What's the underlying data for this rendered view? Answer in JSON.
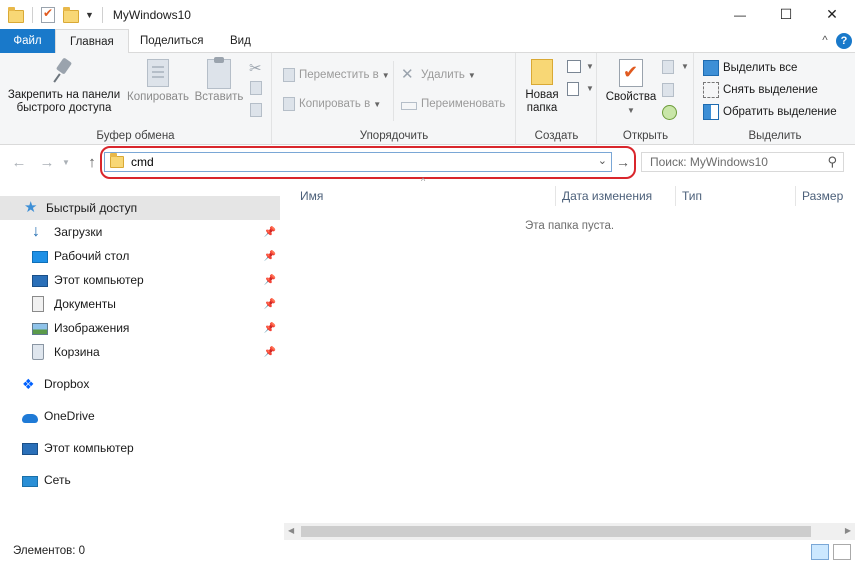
{
  "window": {
    "title": "MyWindows10",
    "minimize_glyph": "—",
    "maximize_glyph": "☐",
    "close_glyph": "✕"
  },
  "tabs": {
    "file": "Файл",
    "home": "Главная",
    "share": "Поделиться",
    "view": "Вид",
    "collapse_glyph": "^",
    "help_glyph": "?"
  },
  "ribbon": {
    "clipboard": {
      "label": "Буфер обмена",
      "pin_line1": "Закрепить на панели",
      "pin_line2": "быстрого доступа",
      "copy": "Копировать",
      "paste": "Вставить"
    },
    "organize": {
      "label": "Упорядочить",
      "move_to": "Переместить в",
      "copy_to": "Копировать в",
      "delete": "Удалить",
      "rename": "Переименовать"
    },
    "new": {
      "label": "Создать",
      "new_folder_line1": "Новая",
      "new_folder_line2": "папка"
    },
    "open": {
      "label": "Открыть",
      "properties": "Свойства"
    },
    "select": {
      "label": "Выделить",
      "select_all": "Выделить все",
      "select_none": "Снять выделение",
      "invert": "Обратить выделение"
    }
  },
  "address": {
    "value": "cmd",
    "search_placeholder": "Поиск: MyWindows10"
  },
  "nav": {
    "quick_access": "Быстрый доступ",
    "items": [
      {
        "label": "Загрузки"
      },
      {
        "label": "Рабочий стол"
      },
      {
        "label": "Этот компьютер"
      },
      {
        "label": "Документы"
      },
      {
        "label": "Изображения"
      },
      {
        "label": "Корзина"
      }
    ],
    "dropbox": "Dropbox",
    "onedrive": "OneDrive",
    "this_pc": "Этот компьютер",
    "network": "Сеть"
  },
  "columns": {
    "name": "Имя",
    "date": "Дата изменения",
    "type": "Тип",
    "size": "Размер"
  },
  "content": {
    "empty_message": "Эта папка пуста."
  },
  "status": {
    "items": "Элементов: 0"
  },
  "colors": {
    "accent": "#1979ca",
    "highlight_ring": "#d9262c",
    "selection": "#cce8ff"
  }
}
